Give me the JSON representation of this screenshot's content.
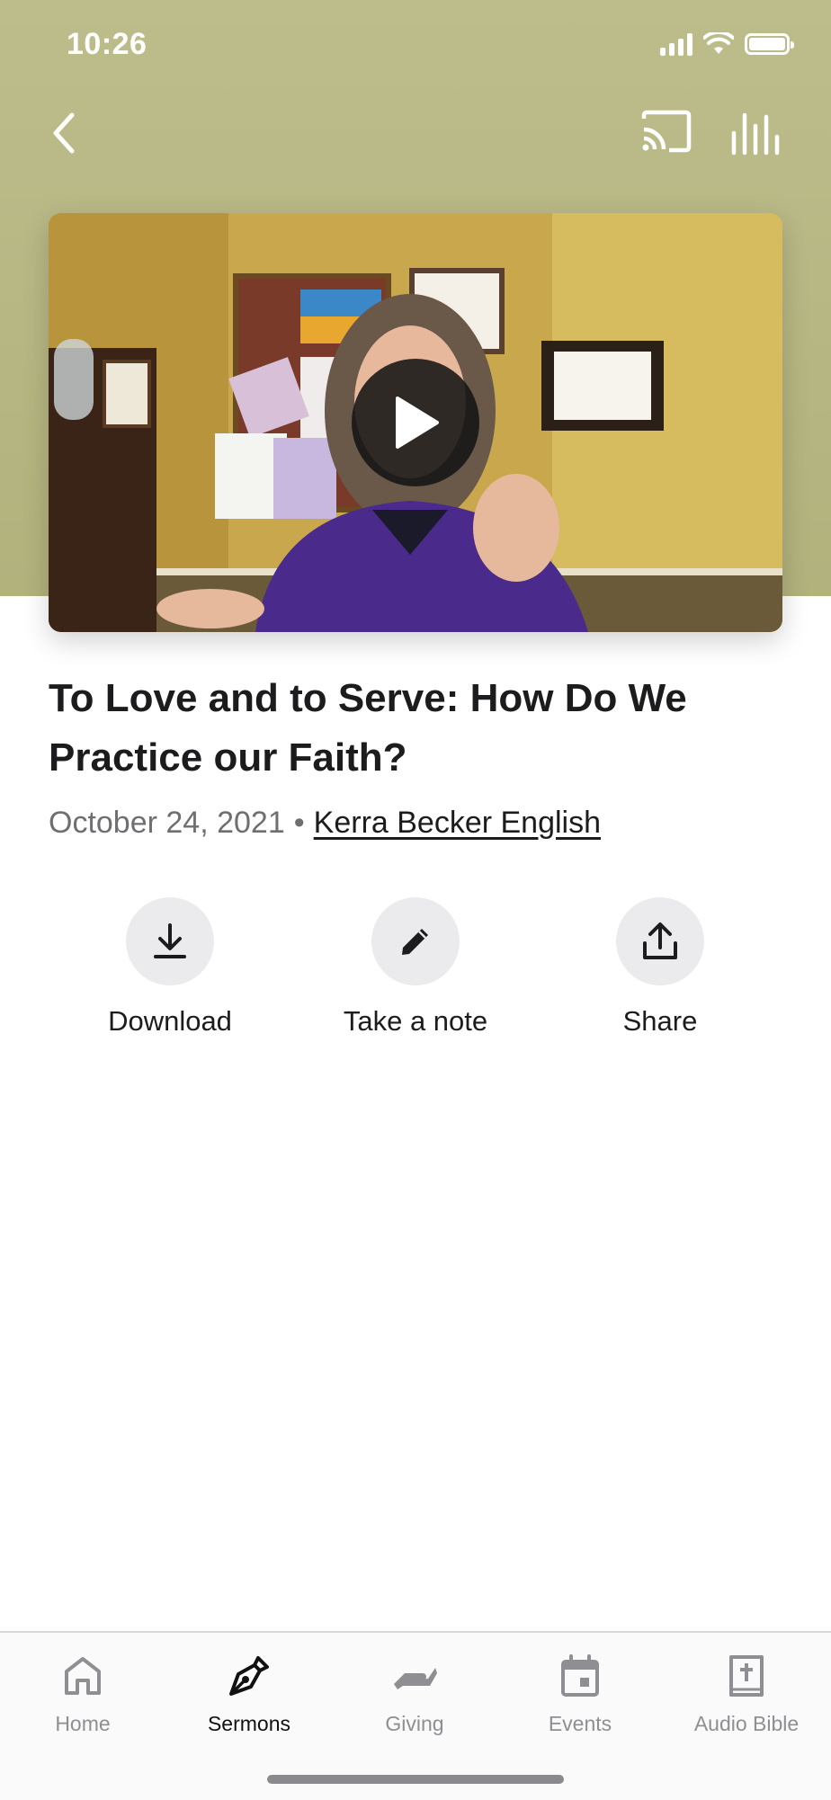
{
  "status_bar": {
    "time": "10:26"
  },
  "sermon": {
    "title": "To Love and to Serve: How Do We Practice our Faith?",
    "date": "October 24, 2021",
    "separator": "•",
    "author": "Kerra Becker English"
  },
  "actions": [
    {
      "label": "Download",
      "icon": "download-icon"
    },
    {
      "label": "Take a note",
      "icon": "pencil-icon"
    },
    {
      "label": "Share",
      "icon": "share-icon"
    }
  ],
  "tabs": [
    {
      "label": "Home",
      "icon": "home-icon",
      "active": false
    },
    {
      "label": "Sermons",
      "icon": "pen-nib-icon",
      "active": true
    },
    {
      "label": "Giving",
      "icon": "giving-hand-icon",
      "active": false
    },
    {
      "label": "Events",
      "icon": "calendar-icon",
      "active": false
    },
    {
      "label": "Audio Bible",
      "icon": "bible-icon",
      "active": false
    }
  ],
  "colors": {
    "header_background": "#b8b884",
    "accent_text": "#1c1c1e",
    "muted_text": "#6e6e73",
    "tab_inactive": "#8e8e93"
  }
}
